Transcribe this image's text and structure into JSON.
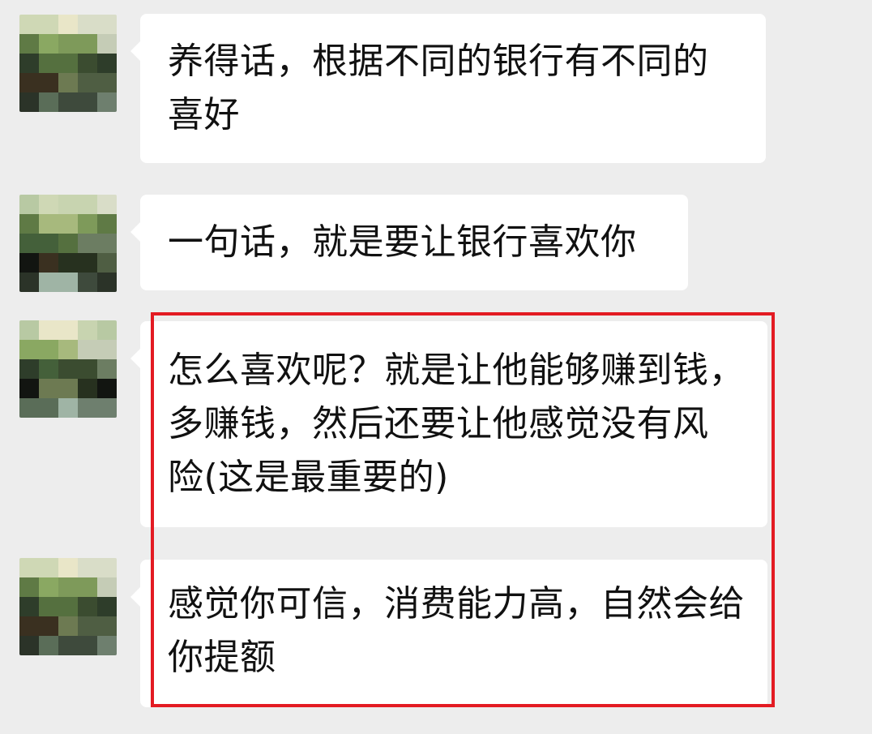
{
  "messages": [
    {
      "lines": [
        "养得话，根据不同的银行有不同的",
        "喜好"
      ]
    },
    {
      "lines": [
        "一句话，就是要让银行喜欢你"
      ]
    },
    {
      "lines": [
        "怎么喜欢呢？就是让他能够赚到钱，",
        "多赚钱，然后还要让他感觉没有风",
        "险(这是最重要的)"
      ]
    },
    {
      "lines": [
        "感觉你可信，消费能力高，自然会给",
        "你提额"
      ]
    }
  ],
  "colors": {
    "background": "#ededed",
    "bubble": "#ffffff",
    "highlight": "#e31b23"
  }
}
